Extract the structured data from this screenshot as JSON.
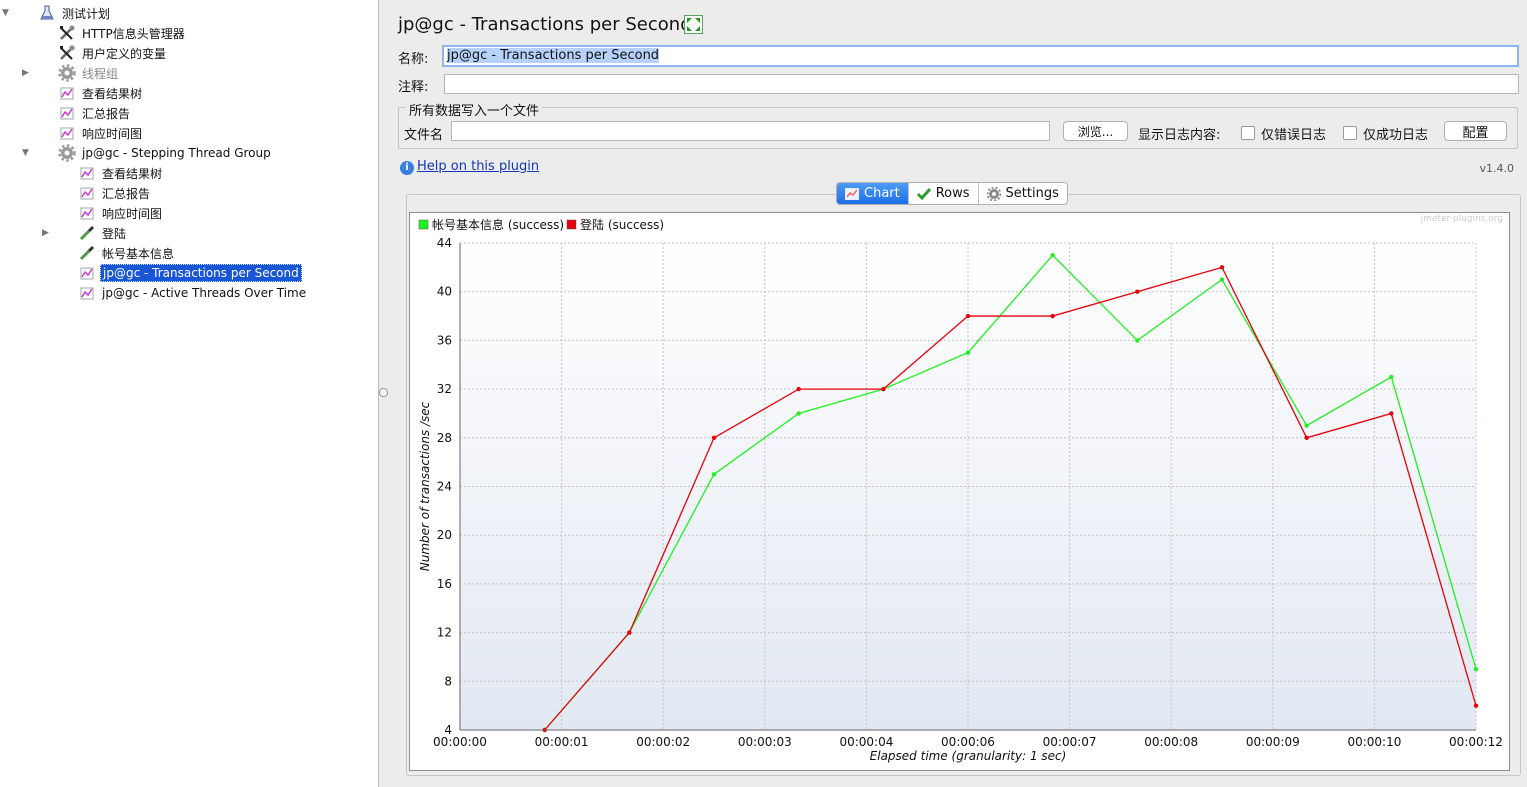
{
  "tree": {
    "items": [
      {
        "label": "测试计划",
        "icon": "flask-icon",
        "depth": 0,
        "toggle": "expanded"
      },
      {
        "label": "HTTP信息头管理器",
        "icon": "tools-icon",
        "depth": 1,
        "toggle": "none"
      },
      {
        "label": "用户定义的变量",
        "icon": "tools-icon",
        "depth": 1,
        "toggle": "none"
      },
      {
        "label": "线程组",
        "icon": "gear-icon",
        "depth": 1,
        "toggle": "collapsed",
        "disabled": true
      },
      {
        "label": "查看结果树",
        "icon": "chart-icon",
        "depth": 1,
        "toggle": "none"
      },
      {
        "label": "汇总报告",
        "icon": "chart-icon",
        "depth": 1,
        "toggle": "none"
      },
      {
        "label": "响应时间图",
        "icon": "chart-icon",
        "depth": 1,
        "toggle": "none"
      },
      {
        "label": "jp@gc - Stepping Thread Group",
        "icon": "gear-icon",
        "depth": 1,
        "toggle": "expanded"
      },
      {
        "label": "查看结果树",
        "icon": "chart-icon",
        "depth": 2,
        "toggle": "none"
      },
      {
        "label": "汇总报告",
        "icon": "chart-icon",
        "depth": 2,
        "toggle": "none"
      },
      {
        "label": "响应时间图",
        "icon": "chart-icon",
        "depth": 2,
        "toggle": "none"
      },
      {
        "label": "登陆",
        "icon": "pipette-icon",
        "depth": 2,
        "toggle": "collapsed"
      },
      {
        "label": "帐号基本信息",
        "icon": "pipette-icon",
        "depth": 2,
        "toggle": "none"
      },
      {
        "label": "jp@gc - Transactions per Second",
        "icon": "chart-icon",
        "depth": 2,
        "toggle": "none",
        "selected": true
      },
      {
        "label": "jp@gc - Active Threads Over Time",
        "icon": "chart-icon",
        "depth": 2,
        "toggle": "none"
      }
    ]
  },
  "panel": {
    "title": "jp@gc - Transactions per Second",
    "name_label": "名称:",
    "name_value": "jp@gc - Transactions per Second",
    "comment_label": "注释:",
    "comment_value": "",
    "file_group_title": "所有数据写入一个文件",
    "filename_label": "文件名",
    "filename_value": "",
    "browse_button": "浏览...",
    "log_label": "显示日志内容:",
    "errors_only_label": "仅错误日志",
    "errors_only_checked": false,
    "success_only_label": "仅成功日志",
    "success_only_checked": false,
    "configure_button": "配置",
    "help_link": "Help on this plugin",
    "version": "v1.4.0"
  },
  "tabs": [
    {
      "label": "Chart",
      "icon": "chart-tab-icon",
      "active": true
    },
    {
      "label": "Rows",
      "icon": "checkmark-icon",
      "active": false
    },
    {
      "label": "Settings",
      "icon": "gear-icon",
      "active": false
    }
  ],
  "colors": {
    "series_green": "#1ff21f",
    "series_red": "#e8000b",
    "selection": "#1856d6",
    "plot_bottom": "#e2e8f2"
  },
  "chart_data": {
    "type": "line",
    "watermark": "jmeter-plugins.org",
    "xlabel": "Elapsed time (granularity: 1 sec)",
    "ylabel": "Number of transactions /sec",
    "ylim": [
      4,
      44
    ],
    "xlim_sec": [
      0,
      12
    ],
    "yticks": [
      4,
      8,
      12,
      16,
      20,
      24,
      28,
      32,
      36,
      40,
      44
    ],
    "xticks": [
      {
        "t": 0,
        "label": "00:00:00"
      },
      {
        "t": 1.2,
        "label": "00:00:01"
      },
      {
        "t": 2.4,
        "label": "00:00:02"
      },
      {
        "t": 3.6,
        "label": "00:00:03"
      },
      {
        "t": 4.8,
        "label": "00:00:04"
      },
      {
        "t": 6.0,
        "label": "00:00:06"
      },
      {
        "t": 7.2,
        "label": "00:00:07"
      },
      {
        "t": 8.4,
        "label": "00:00:08"
      },
      {
        "t": 9.6,
        "label": "00:00:09"
      },
      {
        "t": 10.8,
        "label": "00:00:10"
      },
      {
        "t": 12.0,
        "label": "00:00:12"
      }
    ],
    "grid": true,
    "legend_position": "top-left",
    "series": [
      {
        "name": "帐号基本信息 (success)",
        "color": "#1ff21f",
        "x": [
          1.0,
          2.0,
          3.0,
          4.0,
          5.0,
          6.0,
          7.0,
          8.0,
          9.0,
          10.0,
          11.0,
          12.0
        ],
        "values": [
          4,
          12,
          25,
          30,
          32,
          35,
          43,
          36,
          41,
          29,
          33,
          9
        ]
      },
      {
        "name": "登陆 (success)",
        "color": "#e8000b",
        "x": [
          1.0,
          2.0,
          3.0,
          4.0,
          5.0,
          6.0,
          7.0,
          8.0,
          9.0,
          10.0,
          11.0,
          12.0
        ],
        "values": [
          4,
          12,
          28,
          32,
          32,
          38,
          38,
          40,
          42,
          28,
          30,
          6
        ]
      }
    ]
  }
}
